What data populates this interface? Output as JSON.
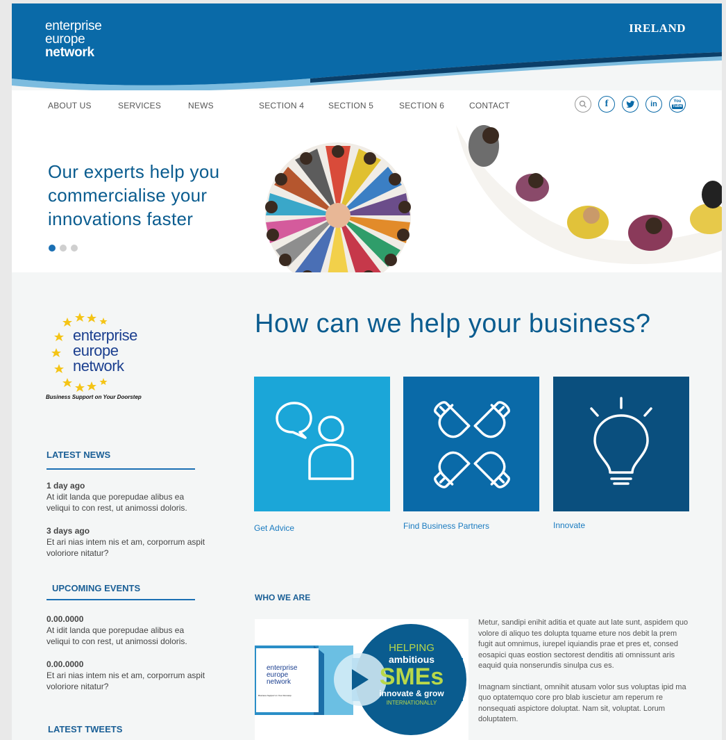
{
  "header": {
    "logo": {
      "line1": "enterprise",
      "line2": "europe",
      "line3": "network"
    },
    "country": "IRELAND"
  },
  "nav": {
    "items": [
      "ABOUT US",
      "SERVICES",
      "NEWS",
      "SECTION 4",
      "SECTION 5",
      "SECTION 6",
      "CONTACT"
    ],
    "social": [
      "search-icon",
      "facebook-icon",
      "twitter-icon",
      "linkedin-icon",
      "youtube-icon"
    ],
    "social_labels": {
      "facebook": "f",
      "linkedin": "in",
      "youtube_top": "You",
      "youtube_bottom": "Tube"
    }
  },
  "hero": {
    "headline": "Our experts help you commercialise your innovations faster",
    "slides": 3,
    "active_slide": 1
  },
  "sidebar": {
    "logo": {
      "line1": "enterprise",
      "line2": "europe",
      "line3": "network",
      "tagline": "Business Support on Your Doorstep"
    },
    "latest_news": {
      "title": "LATEST NEWS",
      "items": [
        {
          "when": "1 day ago",
          "text": "At idit landa que porepudae alibus ea veliqui to con rest, ut animossi doloris."
        },
        {
          "when": "3 days ago",
          "text": "Et ari nias intem nis et am, corporrum aspit voloriore nitatur?"
        }
      ]
    },
    "upcoming_events": {
      "title": "UPCOMING EVENTS",
      "items": [
        {
          "when": "0.00.0000",
          "text": "At idit landa que porepudae alibus ea veliqui to con rest, ut animossi doloris."
        },
        {
          "when": "0.00.0000",
          "text": "Et ari nias intem nis et am, corporrum aspit voloriore nitatur?"
        }
      ]
    },
    "latest_tweets": {
      "title": "LATEST TWEETS"
    }
  },
  "main": {
    "title": "How can we help your business?",
    "tiles": [
      {
        "label": "Get Advice",
        "color": "#1ba6d8",
        "icon": "advice-icon"
      },
      {
        "label": "Find Business Partners",
        "color": "#0a6aa8",
        "icon": "partners-icon"
      },
      {
        "label": "Innovate",
        "color": "#0a4f7e",
        "icon": "lightbulb-icon"
      }
    ],
    "who": {
      "title": "WHO WE ARE",
      "video": {
        "logo_line1": "enterprise",
        "logo_line2": "europe",
        "logo_line3": "network",
        "logo_tagline": "Business Support on Your Doorstep",
        "line1": "HELPING",
        "line2": "ambitious",
        "line3": "SMEs",
        "line4": "innovate & grow",
        "line5": "INTERNATIONALLY"
      },
      "paragraphs": [
        "Metur, sandipi enihit aditia et quate aut late sunt, aspidem quo volore di aliquo tes dolupta tquame eture nos debit la prem fugit aut omnimus, iurepel iquiandis prae et pres et, consed eosapici quas eostion sectorest denditis ati omnissunt aris eaquid quia nonserundis sinulpa cus es.",
        "Imagnam sinctiant, omnihit atusam volor sus voluptas ipid ma quo optatemquo core pro blab iuscietur am reperum re nonsequati aspictore doluptat. Nam sit, voluptat. Lorum doluptatem."
      ]
    }
  },
  "colors": {
    "brand_blue": "#0a6aa8",
    "light_blue": "#1ba6d8",
    "dark_blue": "#0a4f7e"
  }
}
